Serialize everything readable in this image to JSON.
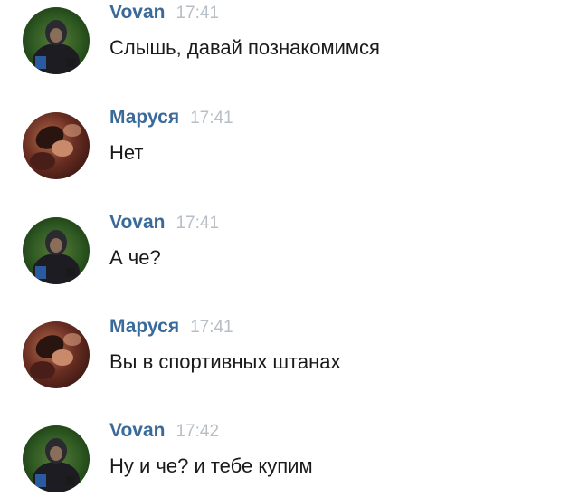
{
  "messages": [
    {
      "author": "Vovan",
      "time": "17:41",
      "text": "Слышь, давай познакомимся",
      "avatar": "vovan-avatar"
    },
    {
      "author": "Маруся",
      "time": "17:41",
      "text": "Нет",
      "avatar": "marusya-avatar"
    },
    {
      "author": "Vovan",
      "time": "17:41",
      "text": "А че?",
      "avatar": "vovan-avatar"
    },
    {
      "author": "Маруся",
      "time": "17:41",
      "text": "Вы в спортивных штанах",
      "avatar": "marusya-avatar"
    },
    {
      "author": "Vovan",
      "time": "17:42",
      "text": "Ну и че? и тебе купим",
      "avatar": "vovan-avatar"
    }
  ],
  "colors": {
    "author": "#3a6a9a",
    "time": "#b8bec6",
    "text": "#1a1a1a"
  }
}
